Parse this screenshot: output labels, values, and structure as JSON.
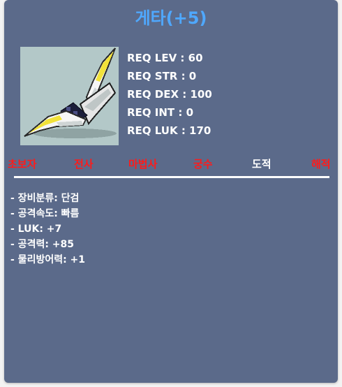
{
  "item": {
    "name": "게타(+5)",
    "image_icon": "dagger-item-icon"
  },
  "requirements": [
    "REQ LEV : 60",
    "REQ STR : 0",
    "REQ DEX : 100",
    "REQ INT : 0",
    "REQ LUK : 170"
  ],
  "jobs": [
    {
      "label": "초보자",
      "equippable": false
    },
    {
      "label": "전사",
      "equippable": false
    },
    {
      "label": "마법사",
      "equippable": false
    },
    {
      "label": "궁수",
      "equippable": false
    },
    {
      "label": "도적",
      "equippable": true
    },
    {
      "label": "해적",
      "equippable": false
    }
  ],
  "stats": [
    "- 장비분류: 단검",
    "- 공격속도: 빠름",
    "- LUK: +7",
    "- 공격력: +85",
    "- 물리방어력: +1"
  ],
  "colors": {
    "card_bg": "#5b6a8a",
    "title": "#4fa8ff",
    "job_unavailable": "#ff1a1a",
    "job_available": "#ffffff"
  }
}
